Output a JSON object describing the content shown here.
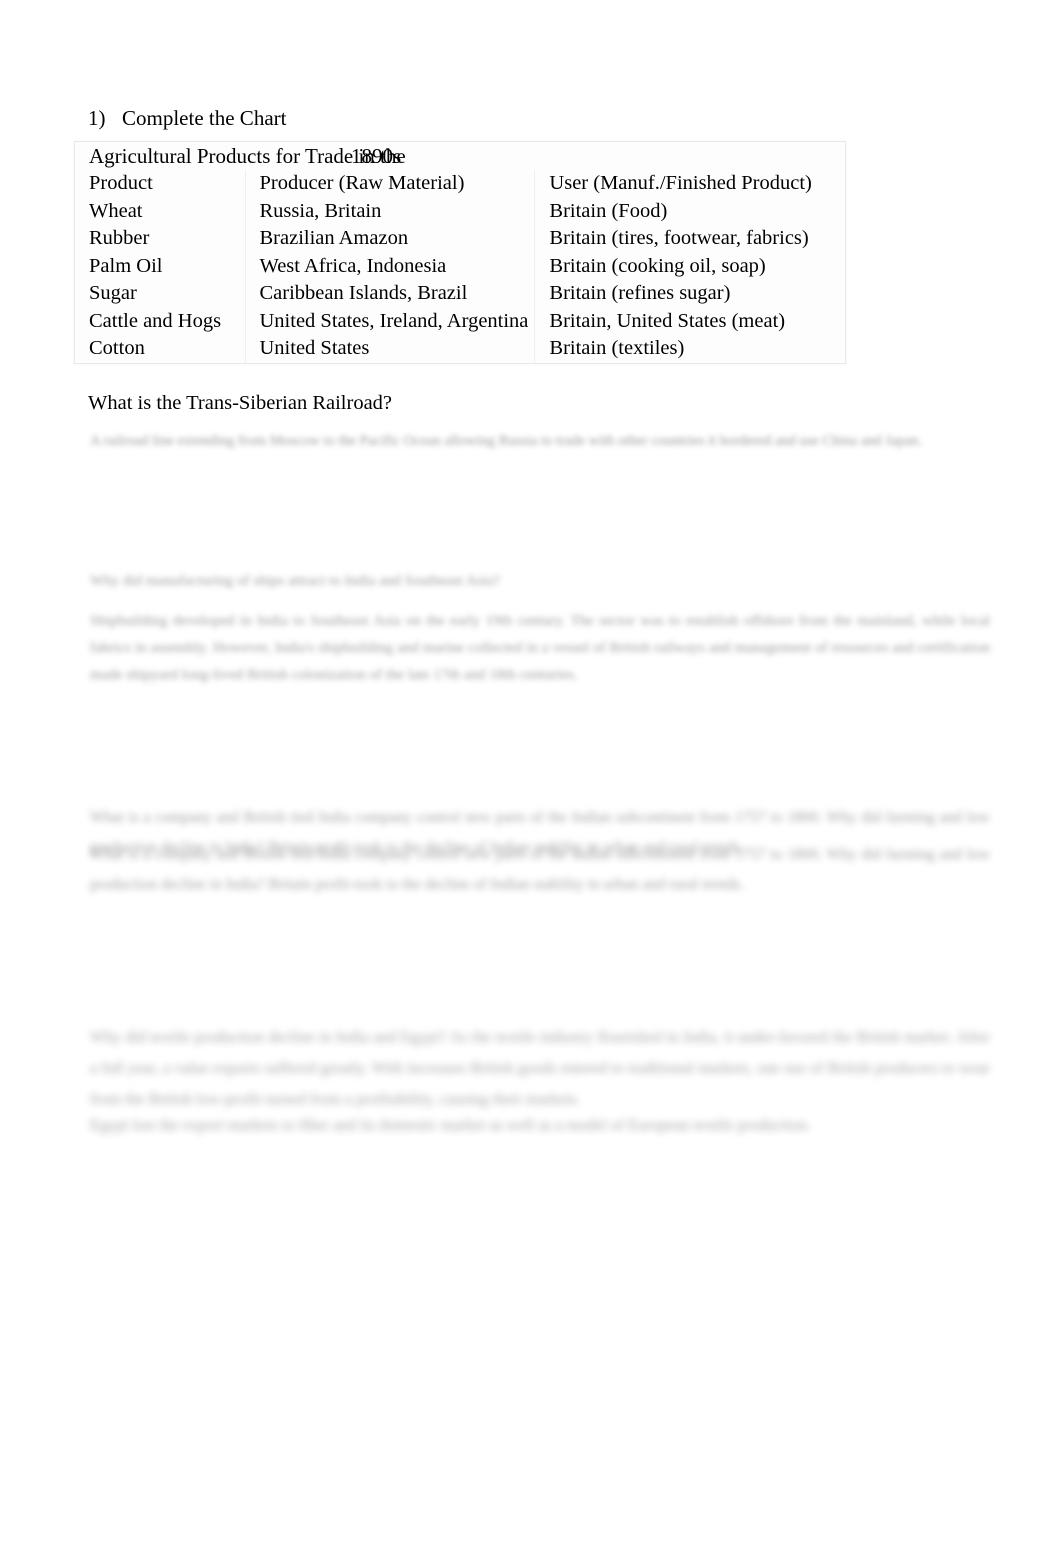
{
  "document": {
    "item_number": "1)",
    "item_title": "Complete the Chart"
  },
  "table": {
    "caption_main": "Agricultural Products for Trade in the",
    "caption_overlap": "1890s",
    "columns": [
      "Product",
      "Producer (Raw Material)",
      "User (Manuf./Finished Product)"
    ],
    "rows": [
      [
        "Wheat",
        "Russia, Britain",
        "Britain (Food)"
      ],
      [
        "Rubber",
        "Brazilian Amazon",
        "Britain (tires, footwear, fabrics)"
      ],
      [
        "Palm Oil",
        "West Africa, Indonesia",
        "Britain (cooking oil, soap)"
      ],
      [
        "Sugar",
        "Caribbean Islands, Brazil",
        "Britain (refines sugar)"
      ],
      [
        "Cattle and Hogs",
        "United States, Ireland, Argentina",
        "Britain, United States (meat)"
      ],
      [
        "Cotton",
        "United States",
        "Britain (textiles)"
      ]
    ]
  },
  "questions": [
    {
      "prompt": "What is the Trans-Siberian Railroad?",
      "answer": "A railroad line extending from Moscow to the Pacific Ocean allowing Russia to trade with other countries it bordered and use China and Japan."
    }
  ],
  "redacted": {
    "heading_2": "Why did manufacturing of ships attract to India and Southeast Asia?",
    "answer_2": "Shipbuilding developed in India to Southeast Asia on the early 19th century. The sector was to establish offshore from the mainland, while local fabrics in assembly. However, India's shipbuilding and marine collected in a vessel of British railways and management of resources and certification made shipyard long-lived British colonization of the late 17th and 18th centuries.",
    "heading_3": "What is a company and British tied India company control new parts of the Indian subcontinent from 1757 to 1800. Why did farming and low production decline in India? Britain profit-took to the decline of Indian stability in urban and rural trends.",
    "answer_4": "Why did textile production decline in India and Egypt? As the textile industry flourished in India, it under-favored the British market. After a full year, a value exports suffered greatly. With increases British goods entered to traditional markets, one use of British producers to wear from the British low-profit turned from a profitability, causing their markets.",
    "answer_5": "Egypt lost the export markets to fiber and its domestic market as well as a model of European textile production."
  }
}
